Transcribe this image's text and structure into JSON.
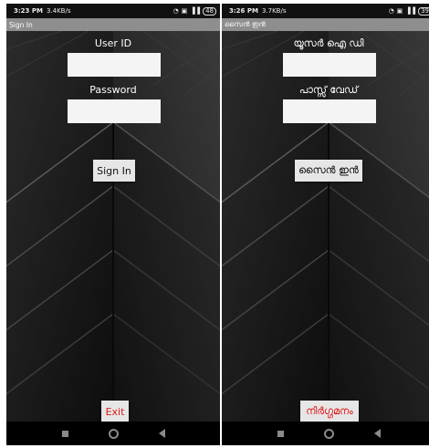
{
  "left": {
    "status": {
      "time": "3:23 PM",
      "speed": "3.4KB/s",
      "battery": "48"
    },
    "title": "Sign In",
    "user_id_label": "User ID",
    "password_label": "Password",
    "sign_in_button": "Sign In",
    "exit_button": "Exit"
  },
  "right": {
    "status": {
      "time": "3:26 PM",
      "speed": "3.7KB/s",
      "battery": "39"
    },
    "title": "സൈൻ ഇൻ",
    "user_id_label": "യൂസർ ഐ ഡി",
    "password_label": "പാസ്സ് വേഡ്",
    "sign_in_button": "സൈൻ ഇൻ",
    "exit_button": "നിർഗ്ഗമനം"
  },
  "colors": {
    "title_bar": "#8e8e8e",
    "exit_text": "#e01919",
    "input_bg": "#f4f4f4",
    "button_bg": "#e6e6e6"
  },
  "icons": [
    "wifi-icon",
    "sim-icon",
    "signal-icon",
    "battery-icon",
    "nav-recents-icon",
    "nav-home-icon",
    "nav-back-icon"
  ]
}
